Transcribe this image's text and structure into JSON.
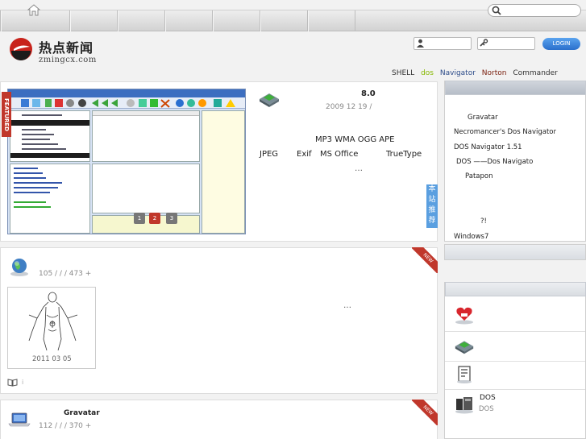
{
  "topnav": {
    "home_icon": "home-icon",
    "search_placeholder": ""
  },
  "logo": {
    "name_cn": "热点新闻",
    "domain": "zmingcx.com"
  },
  "login": {
    "button_label": "LOGIN"
  },
  "tags": [
    "SHELL",
    "dos",
    "Navigator",
    "Norton",
    "Commander"
  ],
  "tag_colors": [
    "#333333",
    "#86b800",
    "#2e4d8a",
    "#7a1f0e",
    "#333333"
  ],
  "featured": {
    "badge": "FEATURED",
    "version": "8.0",
    "date": "2009 12 19 /",
    "formats_audio": "MP3  WMA  OGG  APE",
    "formats_line": [
      "JPEG",
      "Exif",
      "MS Office",
      "TrueType"
    ],
    "ellipsis": "…",
    "pages": [
      "1",
      "2",
      "3"
    ]
  },
  "recommend_label": "本站推荐",
  "post1": {
    "badge": "NEW",
    "meta": "105  /  /  /  473 +",
    "thumb_date": "2011 03 05",
    "ellipsis": "…",
    "footer_mark": "i"
  },
  "post2": {
    "badge": "NEW",
    "title": "Gravatar",
    "meta": "112  /  /  /  370 +"
  },
  "sidebar": {
    "list": [
      "Gravatar",
      "Necromancer's Dos Navigator",
      "DOS Navigator 1.51",
      "DOS    ——Dos Navigato",
      "Patapon",
      "?!",
      "Windows7"
    ],
    "bottom_title": "DOS",
    "bottom_sub": "DOS"
  }
}
